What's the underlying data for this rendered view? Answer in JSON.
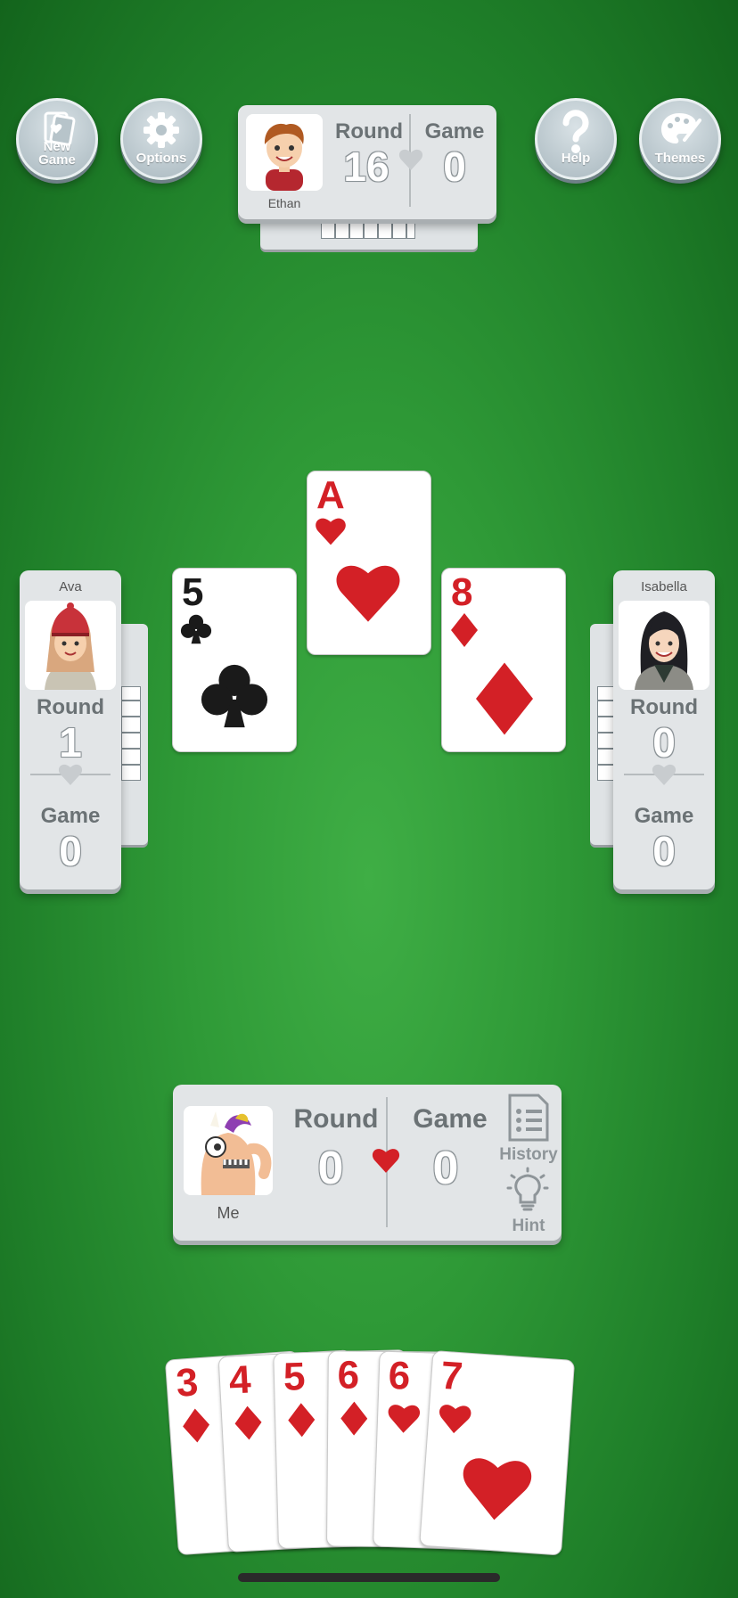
{
  "top_buttons": {
    "new_game": "New\nGame",
    "options": "Options",
    "help": "Help",
    "themes": "Themes"
  },
  "players": {
    "top": {
      "name": "Ethan",
      "round_label": "Round",
      "round": "16",
      "game_label": "Game",
      "game": "0"
    },
    "left": {
      "name": "Ava",
      "round_label": "Round",
      "round": "1",
      "game_label": "Game",
      "game": "0"
    },
    "right": {
      "name": "Isabella",
      "round_label": "Round",
      "round": "0",
      "game_label": "Game",
      "game": "0"
    },
    "me": {
      "name": "Me",
      "round_label": "Round",
      "round": "0",
      "game_label": "Game",
      "game": "0"
    }
  },
  "side_actions": {
    "history": "History",
    "hint": "Hint"
  },
  "trick": {
    "top": {
      "rank": "A",
      "suit": "hearts"
    },
    "left": {
      "rank": "5",
      "suit": "clubs"
    },
    "right": {
      "rank": "8",
      "suit": "diamonds"
    }
  },
  "hand": [
    {
      "rank": "3",
      "suit": "diamonds"
    },
    {
      "rank": "4",
      "suit": "diamonds"
    },
    {
      "rank": "5",
      "suit": "diamonds"
    },
    {
      "rank": "6",
      "suit": "diamonds"
    },
    {
      "rank": "6",
      "suit": "hearts"
    },
    {
      "rank": "7",
      "suit": "hearts"
    }
  ],
  "colors": {
    "felt": "#2f9a37",
    "red_suit": "#d32026",
    "panel": "#e2e5e7"
  }
}
